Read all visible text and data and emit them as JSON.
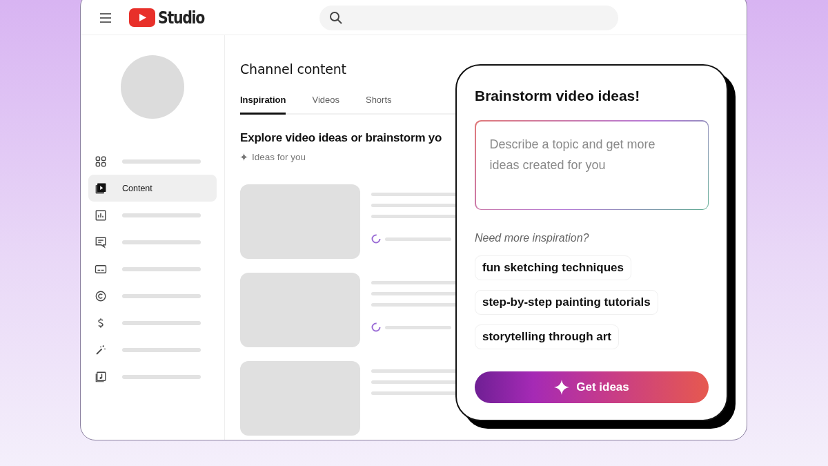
{
  "header": {
    "logo_text": "Studio"
  },
  "sidebar": {
    "items": [
      {
        "selected": false
      },
      {
        "label": "Content",
        "selected": true
      },
      {
        "selected": false
      },
      {
        "selected": false
      },
      {
        "selected": false
      },
      {
        "selected": false
      },
      {
        "selected": false
      },
      {
        "selected": false
      },
      {
        "selected": false
      }
    ]
  },
  "main": {
    "title": "Channel content",
    "tabs": [
      {
        "label": "Inspiration",
        "selected": true
      },
      {
        "label": "Videos",
        "selected": false
      },
      {
        "label": "Shorts",
        "selected": false
      }
    ],
    "heading": "Explore video ideas or brainstorm yo",
    "ideas_label": "Ideas for you"
  },
  "brainstorm": {
    "title": "Brainstorm video ideas!",
    "topic_field": {
      "placeholder": "Describe a topic and get more ideas created for you"
    },
    "inspiration_label": "Need more inspiration?",
    "suggestions": [
      "fun sketching techniques",
      "step-by-step painting tutorials",
      "storytelling through art"
    ],
    "button": "Get ideas"
  }
}
